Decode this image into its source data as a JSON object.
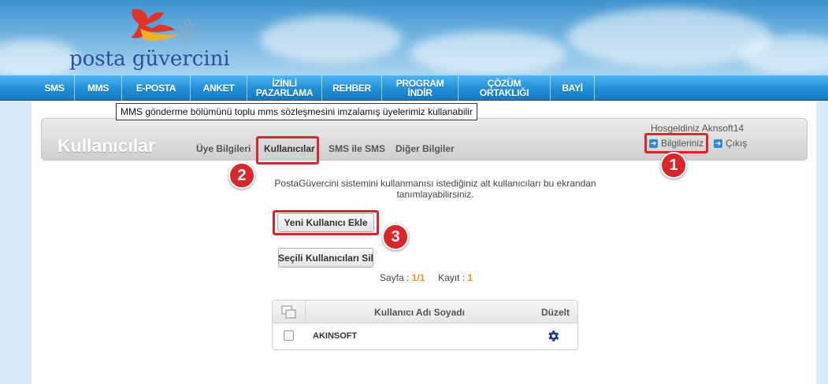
{
  "logo": {
    "text": "posta güvercini"
  },
  "nav": {
    "items": [
      {
        "label": "SMS"
      },
      {
        "label": "MMS"
      },
      {
        "label": "E-POSTA"
      },
      {
        "label": "ANKET"
      },
      {
        "label": "İZİNLİ\nPAZARLAMA"
      },
      {
        "label": "REHBER"
      },
      {
        "label": "PROGRAM\nİNDİR"
      },
      {
        "label": "ÇÖZÜM\nORTAKLIĞI"
      },
      {
        "label": "BAYİ"
      }
    ],
    "tooltip": "MMS gönderme bölümünü toplu mms sözleşmesini imzalamış üyelerimiz kullanabilir"
  },
  "panel": {
    "title": "Kullanıcılar",
    "tabs": [
      {
        "label": "Üye Bilgileri"
      },
      {
        "label": "Kullanıcılar"
      },
      {
        "label": "SMS ile SMS"
      },
      {
        "label": "Diğer Bilgiler"
      }
    ],
    "welcome": "Hosgeldiniz Aknsoft14",
    "account_link": "Bilgileriniz",
    "logout_link": "Çıkış"
  },
  "description": "PostaGüvercini sistemini kullanmanısı istediğiniz alt kullanıcıları bu ekrandan tanımlayabilirsiniz.",
  "buttons": {
    "add_user": "Yeni Kullanıcı Ekle",
    "delete_selected": "Seçili Kullanıcıları Sil"
  },
  "pager": {
    "page_label": "Sayfa :",
    "page_value": "1/1",
    "record_label": "Kayıt :",
    "record_value": "1"
  },
  "table": {
    "columns": [
      "Kullanıcı Adı Soyadı",
      "Düzelt"
    ],
    "rows": [
      {
        "name": "AKINSOFT"
      }
    ]
  },
  "badges": [
    "1",
    "2",
    "3"
  ],
  "colors": {
    "nav_blue": "#1f8fd8",
    "highlight_red": "#e0242b",
    "accent_orange": "#f0961b",
    "gear_blue": "#1e3f8a"
  }
}
